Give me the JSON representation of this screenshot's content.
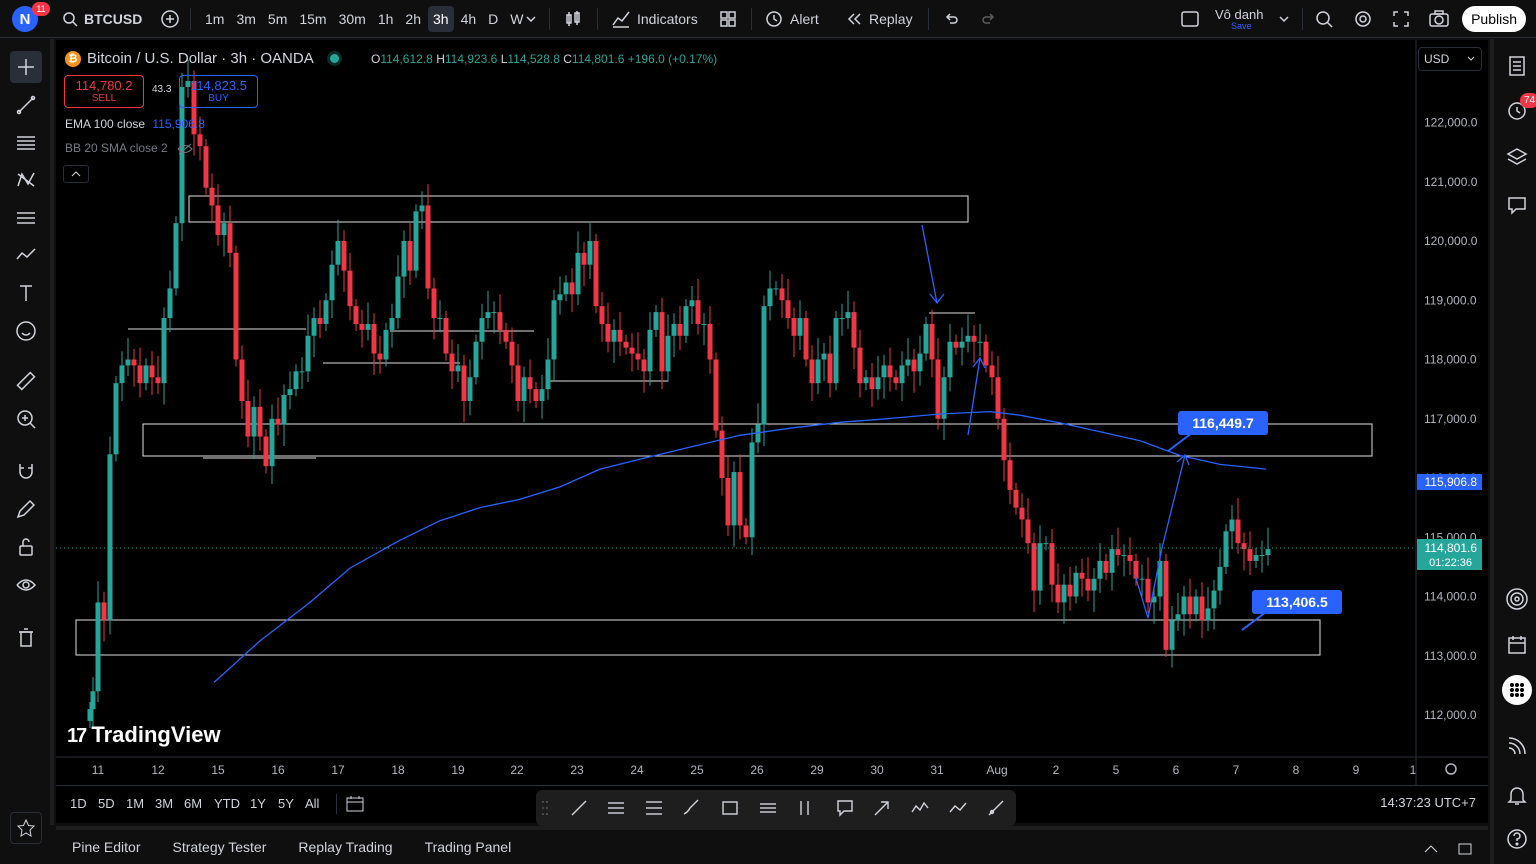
{
  "topbar": {
    "avatar_letter": "N",
    "notification_count": "11",
    "symbol": "BTCUSD",
    "timeframes": [
      "1m",
      "3m",
      "5m",
      "15m",
      "30m",
      "1h",
      "2h",
      "3h",
      "4h",
      "D",
      "W"
    ],
    "active_timeframe": "3h",
    "indicators_label": "Indicators",
    "alert_label": "Alert",
    "replay_label": "Replay",
    "layout_name": "Vô danh",
    "layout_status": "Save",
    "publish_label": "Publish"
  },
  "legend": {
    "title": "Bitcoin / U.S. Dollar · 3h · OANDA",
    "o_key": "O",
    "o_val": "114,612.8",
    "h_key": "H",
    "h_val": "114,923.6",
    "l_key": "L",
    "l_val": "114,528.8",
    "c_key": "C",
    "c_val": "114,801.6",
    "change": "+196.0 (+0.17%)",
    "sell_price": "114,780.2",
    "sell_label": "SELL",
    "spread": "43.3",
    "buy_price": "114,823.5",
    "buy_label": "BUY",
    "ema_label": "EMA 100 close",
    "ema_value": "115,906.8",
    "bb_label": "BB 20 SMA close 2"
  },
  "chart": {
    "currency": "USD",
    "watermark": "TradingView",
    "price_labels": [
      "122,000.0",
      "121,000.0",
      "120,000.0",
      "119,000.0",
      "118,000.0",
      "117,000.0",
      "116,000.0",
      "115,000.0",
      "114,000.0",
      "113,000.0",
      "112,000.0"
    ],
    "ema_tag": "115,906.8",
    "last_price_tag": "114,801.6",
    "countdown": "01:22:36",
    "callout_upper": "116,449.7",
    "callout_lower": "113,406.5",
    "date_labels": [
      "11",
      "12",
      "15",
      "16",
      "17",
      "18",
      "19",
      "22",
      "23",
      "24",
      "25",
      "26",
      "29",
      "30",
      "31",
      "Aug",
      "2",
      "5",
      "6",
      "7",
      "8",
      "9",
      "1"
    ],
    "colors": {
      "up": "#26a69a",
      "down": "#f23645",
      "ema": "#2962ff",
      "accent": "#2962ff"
    }
  },
  "bottom": {
    "ranges": [
      "1D",
      "5D",
      "1M",
      "3M",
      "6M",
      "YTD",
      "1Y",
      "5Y",
      "All"
    ],
    "clock": "14:37:23 UTC+7",
    "panels": [
      "Pine Editor",
      "Strategy Tester",
      "Replay Trading",
      "Trading Panel"
    ]
  },
  "right_toolbar": {
    "alerts_badge": "74"
  }
}
